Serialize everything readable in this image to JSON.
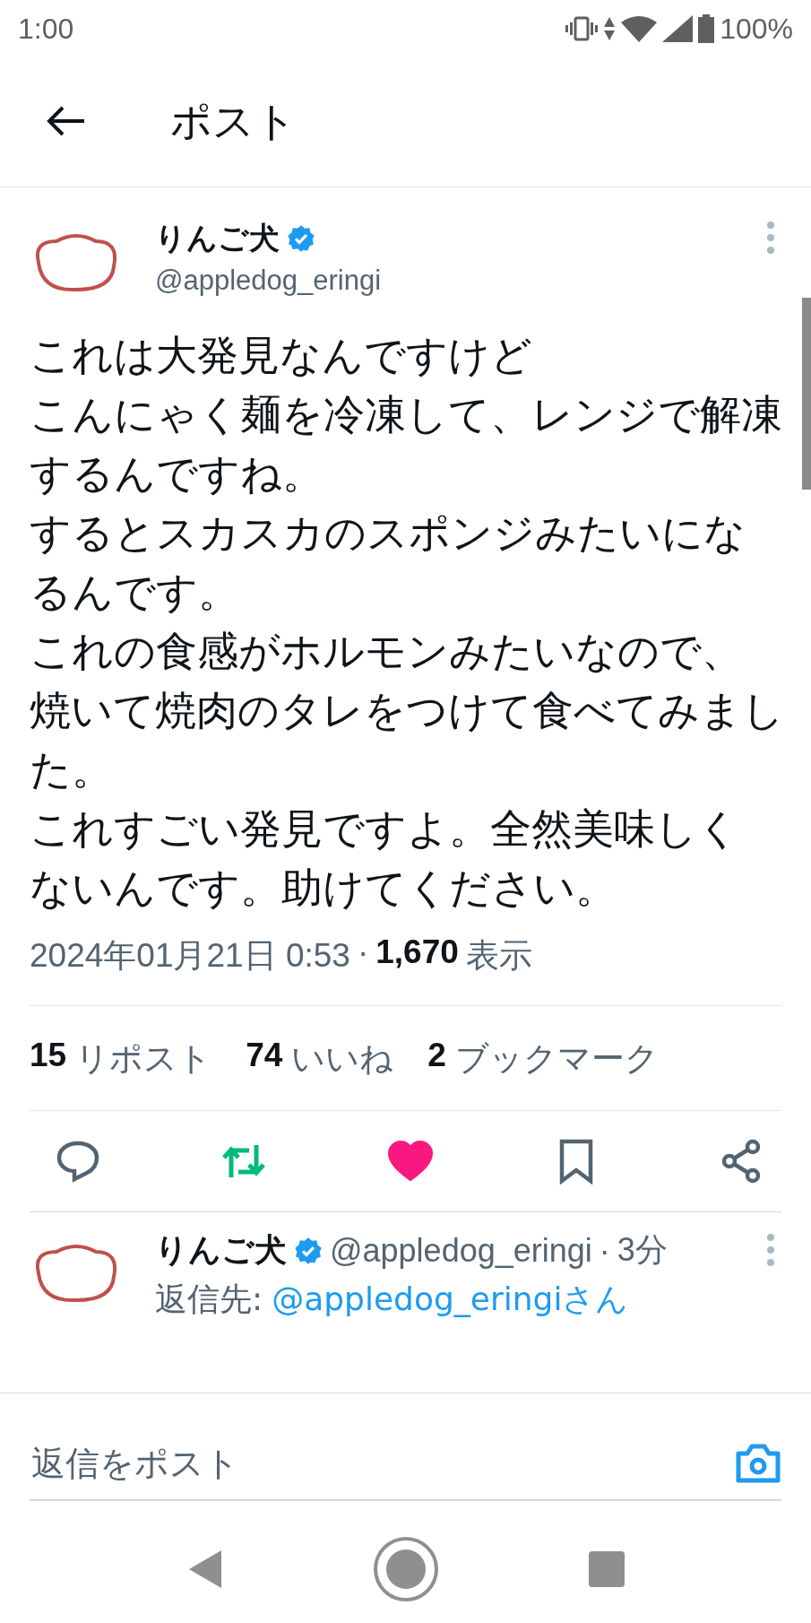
{
  "status_bar": {
    "time": "1:00",
    "battery": "100%"
  },
  "header": {
    "title": "ポスト"
  },
  "post": {
    "author": {
      "name": "りんご犬",
      "verified": true,
      "handle": "@appledog_eringi"
    },
    "text_lines": [
      "これは大発見なんですけど",
      "こんにゃく麺を冷凍して、レンジで解凍",
      "するんですね。",
      "するとスカスカのスポンジみたいにな",
      "るんです。",
      "これの食感がホルモンみたいなので、",
      "焼いて焼肉のタレをつけて食べてみまし",
      "た。",
      "これすごい発見ですよ。全然美味しく",
      "ないんです。助けてください。"
    ],
    "timestamp": "2024年01月21日 0:53",
    "separator": "·",
    "views": "1,670",
    "views_label": "表示",
    "stats": [
      {
        "count": "15",
        "label": "リポスト"
      },
      {
        "count": "74",
        "label": "いいね"
      },
      {
        "count": "2",
        "label": "ブックマーク"
      }
    ],
    "actions": [
      {
        "kind": "reply",
        "active": false
      },
      {
        "kind": "repost",
        "active": true
      },
      {
        "kind": "like",
        "active": true
      },
      {
        "kind": "bookmark",
        "active": false
      },
      {
        "kind": "share",
        "active": false
      }
    ]
  },
  "replies": [
    {
      "name": "りんご犬",
      "verified": true,
      "handle": "@appledog_eringi",
      "separator": "·",
      "time": "3分",
      "reply_to_label": "返信先:",
      "reply_to_handle": "@appledog_eringiさん"
    }
  ],
  "composer": {
    "placeholder": "返信をポスト"
  }
}
